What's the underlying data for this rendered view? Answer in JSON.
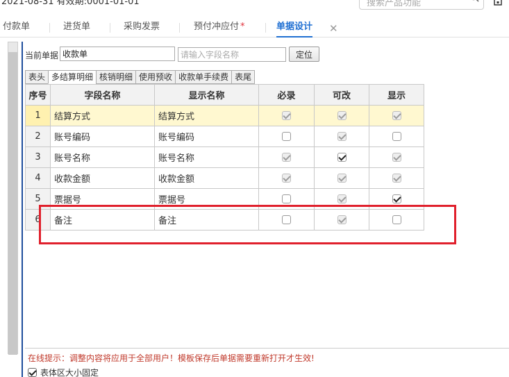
{
  "header": {
    "date_text": "2021-08-31   有效期:0001-01-01",
    "search_placeholder": "搜索产品功能"
  },
  "tabs": [
    {
      "label": "付款单"
    },
    {
      "label": "进货单"
    },
    {
      "label": "采购发票"
    },
    {
      "label": "预付冲应付",
      "star": "*"
    },
    {
      "label": "单据设计"
    }
  ],
  "toolbar": {
    "current_label": "当前单据",
    "current_value": "收款单",
    "field_placeholder": "请输入字段名称",
    "locate_label": "定位"
  },
  "subtabs": [
    "表头",
    "多结算明细",
    "核销明细",
    "使用预收",
    "收款单手续费",
    "表尾"
  ],
  "grid": {
    "headers": {
      "no": "序号",
      "field": "字段名称",
      "display": "显示名称",
      "required": "必录",
      "editable": "可改",
      "visible": "显示"
    },
    "rows": [
      {
        "no": "1",
        "field": "结算方式",
        "display": "结算方式",
        "required": true,
        "editable": true,
        "visible": true
      },
      {
        "no": "2",
        "field": "账号编码",
        "display": "账号编码",
        "required": false,
        "editable": true,
        "visible": false
      },
      {
        "no": "3",
        "field": "账号名称",
        "display": "账号名称",
        "required": true,
        "editable": true,
        "visible": true
      },
      {
        "no": "4",
        "field": "收款金额",
        "display": "收款金额",
        "required": true,
        "editable": true,
        "visible": true
      },
      {
        "no": "5",
        "field": "票据号",
        "display": "票据号",
        "required": false,
        "editable": true,
        "visible": true
      },
      {
        "no": "6",
        "field": "备注",
        "display": "备注",
        "required": false,
        "editable": true,
        "visible": false
      }
    ]
  },
  "footer": {
    "tip": "在线提示：调整内容将应用于全部用户！模板保存后单据需要重新打开才生效!",
    "fix_label": "表体区大小固定",
    "fix_checked": true
  },
  "colors": {
    "accent": "#1f6fd2",
    "annotation": "#e0202c",
    "selected_row": "#fff8d0",
    "tip_text": "#c0392b"
  }
}
